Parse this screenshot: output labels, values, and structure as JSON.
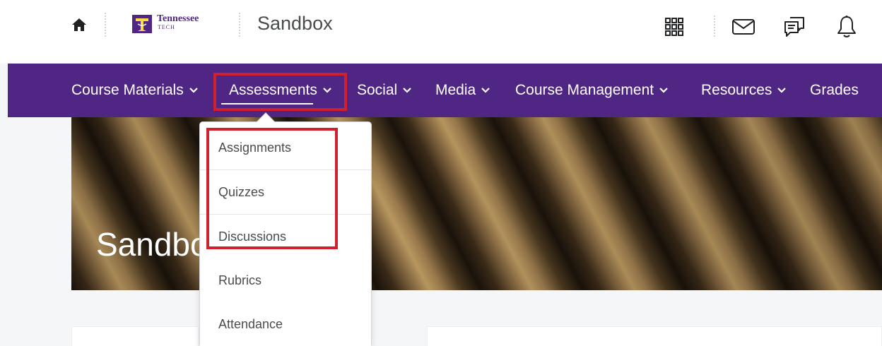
{
  "header": {
    "logo": {
      "line1": "Tennessee",
      "line2": "TECH"
    },
    "course_title": "Sandbox",
    "icons": [
      "home-icon",
      "app-grid-icon",
      "mail-icon",
      "chat-icon",
      "bell-icon"
    ]
  },
  "nav": {
    "items": [
      {
        "label": "Course Materials",
        "has_menu": true
      },
      {
        "label": "Assessments",
        "has_menu": true,
        "active": true
      },
      {
        "label": "Social",
        "has_menu": true
      },
      {
        "label": "Media",
        "has_menu": true
      },
      {
        "label": "Course Management",
        "has_menu": true
      },
      {
        "label": "Resources",
        "has_menu": true
      },
      {
        "label": "Grades",
        "has_menu": false
      }
    ]
  },
  "banner": {
    "title": "Sandbox"
  },
  "dropdown": {
    "items": [
      "Assignments",
      "Quizzes",
      "Discussions",
      "Rubrics",
      "Attendance"
    ]
  },
  "colors": {
    "brand_purple": "#4f2683",
    "highlight_red": "#d0202e",
    "text_gray": "#494c4e"
  }
}
